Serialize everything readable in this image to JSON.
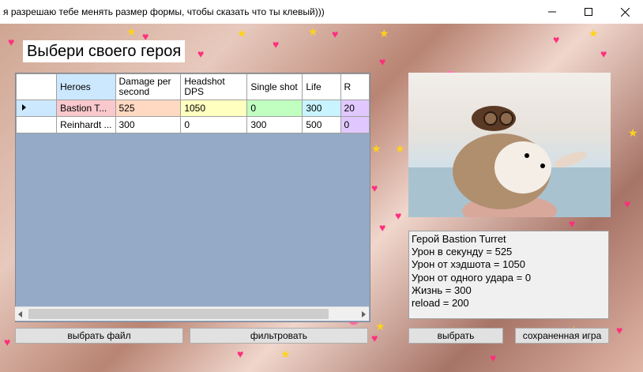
{
  "window": {
    "title": "я разрешаю тебе менять размер формы, чтобы сказать что ты клевый)))"
  },
  "heading": "Выбери своего героя",
  "table": {
    "columns": [
      {
        "label": "Heroes"
      },
      {
        "label": "Damage per second"
      },
      {
        "label": "Headshot DPS"
      },
      {
        "label": "Single shot"
      },
      {
        "label": "Life"
      },
      {
        "label": "R"
      }
    ],
    "rows": [
      {
        "cells": [
          "Bastion T...",
          "525",
          "1050",
          "0",
          "300",
          "20"
        ],
        "selected": true
      },
      {
        "cells": [
          "Reinhardt ...",
          "300",
          "0",
          "300",
          "500",
          "0"
        ],
        "selected": false
      }
    ]
  },
  "info": {
    "lines": [
      "Герой Bastion Turret",
      "Урон в секунду = 525",
      "Урон от хэдшота = 1050",
      "Урон от одного удара = 0",
      "Жизнь = 300",
      "reload = 200"
    ]
  },
  "buttons": {
    "choose_file": "выбрать файл",
    "filter": "фильтровать",
    "choose": "выбрать",
    "saved_game": "сохраненная игра"
  },
  "colors": {
    "name_cell": "#f8c8cc",
    "dps_cell": "#ffd9c2",
    "headshot_cell": "#ffffc0",
    "single_cell": "#c0ffc0",
    "life_cell": "#c8f4ff",
    "reload_cell": "#e0c8ff"
  },
  "icons": [
    "minimize-icon",
    "maximize-icon",
    "close-icon",
    "row-pointer-icon",
    "scroll-left-icon",
    "scroll-right-icon"
  ]
}
